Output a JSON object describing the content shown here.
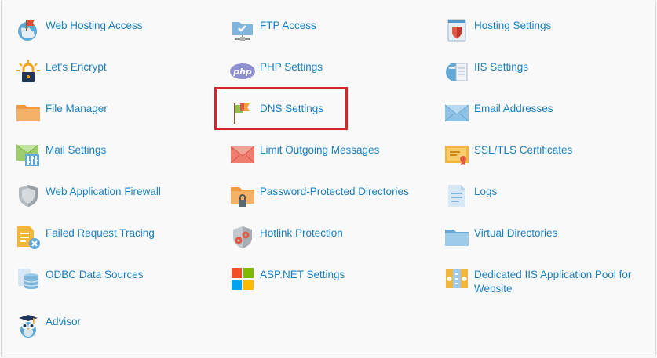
{
  "tools": {
    "web_hosting_access": "Web Hosting Access",
    "ftp_access": "FTP Access",
    "hosting_settings": "Hosting Settings",
    "lets_encrypt": "Let's Encrypt",
    "php_settings": "PHP Settings",
    "iis_settings": "IIS Settings",
    "file_manager": "File Manager",
    "dns_settings": "DNS Settings",
    "email_addresses": "Email Addresses",
    "mail_settings": "Mail Settings",
    "limit_outgoing": "Limit Outgoing Messages",
    "ssl_tls": "SSL/TLS Certificates",
    "waf": "Web Application Firewall",
    "password_dirs": "Password-Protected Directories",
    "logs": "Logs",
    "failed_request": "Failed Request Tracing",
    "hotlink": "Hotlink Protection",
    "virtual_dirs": "Virtual Directories",
    "odbc": "ODBC Data Sources",
    "aspnet": "ASP.NET Settings",
    "dedicated_pool": "Dedicated IIS Application Pool for Website",
    "advisor": "Advisor"
  },
  "icons": {
    "php_badge_text": "php"
  },
  "highlight_color": "#d8232a",
  "link_color": "#1a7fc1"
}
